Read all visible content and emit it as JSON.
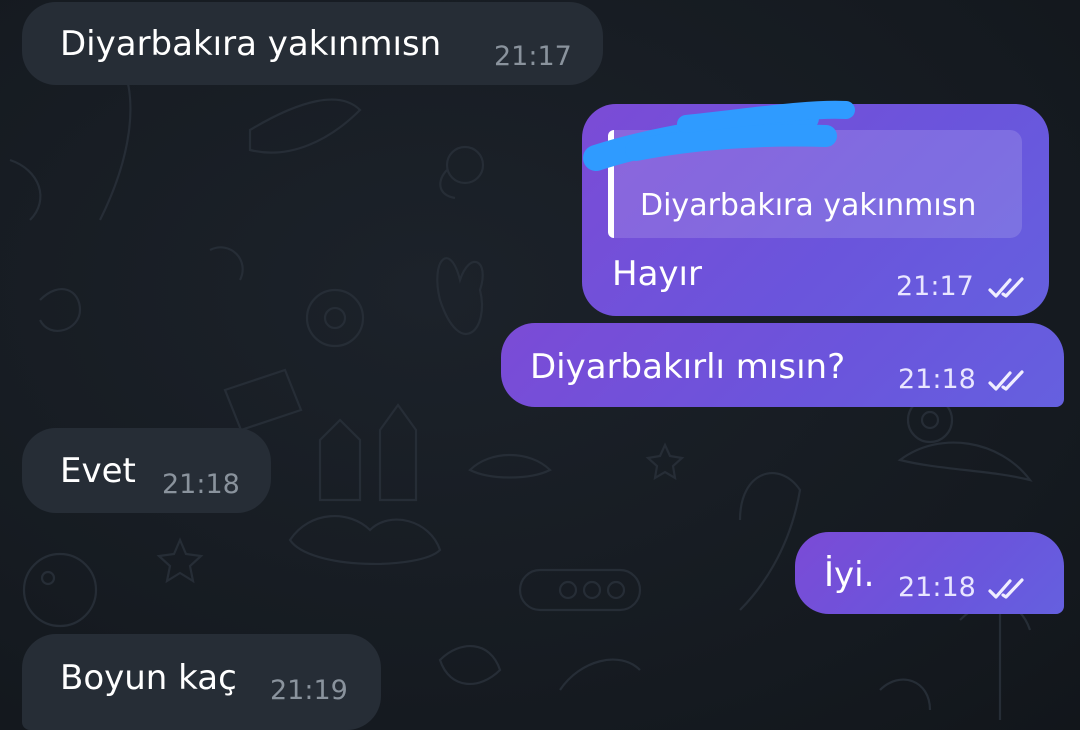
{
  "messages": [
    {
      "direction": "incoming",
      "text": "Diyarbakıra yakınmısn",
      "time": "21:17"
    },
    {
      "direction": "outgoing",
      "reply_to_text": "Diyarbakıra yakınmısn",
      "text": "Hayır",
      "time": "21:17",
      "status": "read"
    },
    {
      "direction": "outgoing",
      "text": "Diyarbakırlı mısın?",
      "time": "21:18",
      "status": "read"
    },
    {
      "direction": "incoming",
      "text": "Evet",
      "time": "21:18"
    },
    {
      "direction": "outgoing",
      "text": "İyi.",
      "time": "21:18",
      "status": "read"
    },
    {
      "direction": "incoming",
      "text": "Boyun kaç",
      "time": "21:19"
    }
  ],
  "colors": {
    "background": "#171c22",
    "incoming_bubble": "#262d36",
    "outgoing_bubble": "#6a55dc",
    "redaction": "#2f9bff"
  },
  "icons": {
    "read_status": "double-check-icon"
  }
}
